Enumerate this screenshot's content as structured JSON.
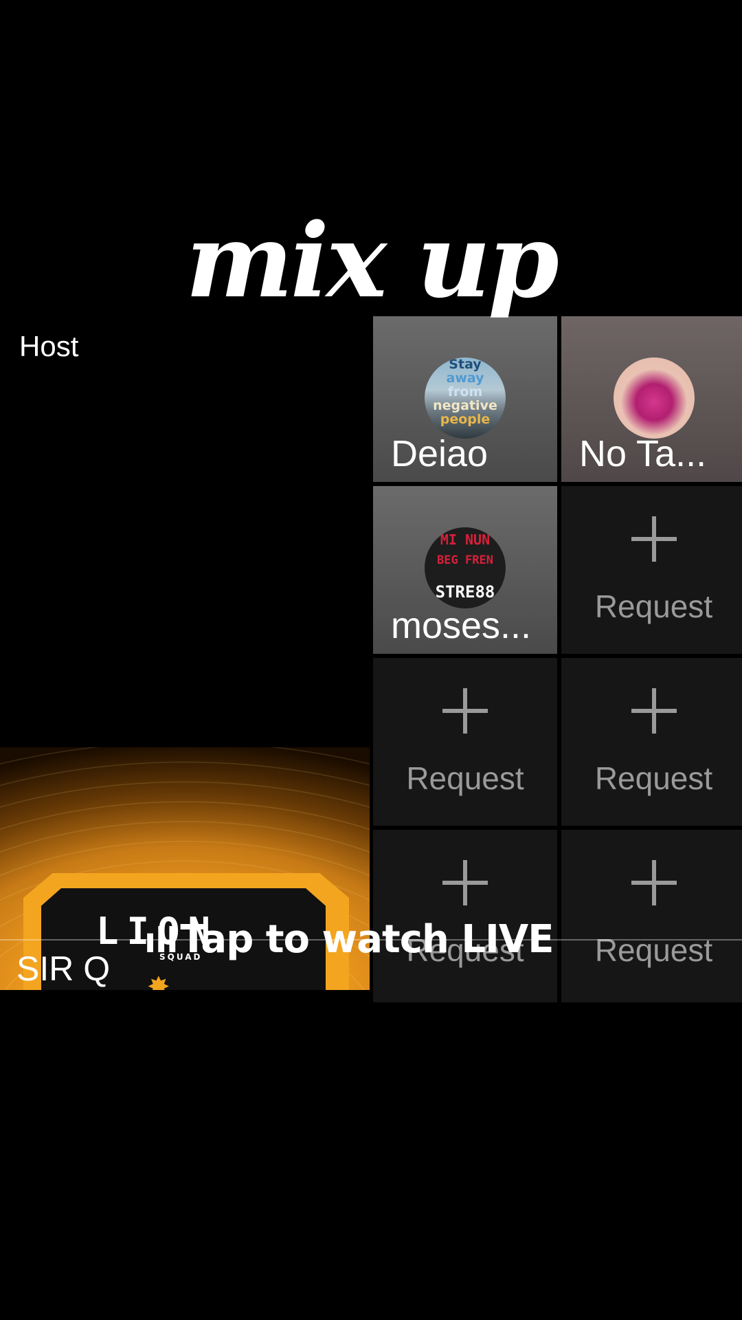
{
  "overlay": {
    "title": "mix up",
    "cta_bars": "ıll",
    "cta": "Tap to watch LIVE"
  },
  "host": {
    "label": "Host",
    "name": "SIR Q",
    "badge_text": "LION",
    "badge_sub": "SQUAD"
  },
  "guests": [
    {
      "name": "Deiao",
      "filled": true,
      "avatar": "stay-away-poster",
      "avatar_lines": [
        "Stay",
        "away",
        "from",
        "negative",
        "people"
      ]
    },
    {
      "name": "No Ta...",
      "filled": true,
      "avatar": "perfume-bottle"
    },
    {
      "name": "moses...",
      "filled": true,
      "avatar": "poster",
      "avatar_lines": [
        "MI NUN",
        "BEG FREN",
        "STRE88"
      ]
    },
    {
      "name": "Request",
      "filled": false
    },
    {
      "name": "Request",
      "filled": false
    },
    {
      "name": "Request",
      "filled": false
    },
    {
      "name": "Request",
      "filled": false
    },
    {
      "name": "Request",
      "filled": false
    }
  ],
  "colors": {
    "background": "#000000",
    "host_accent": "#f3a51f",
    "empty_slot": "#161616",
    "request_text": "#9a9a9a"
  }
}
